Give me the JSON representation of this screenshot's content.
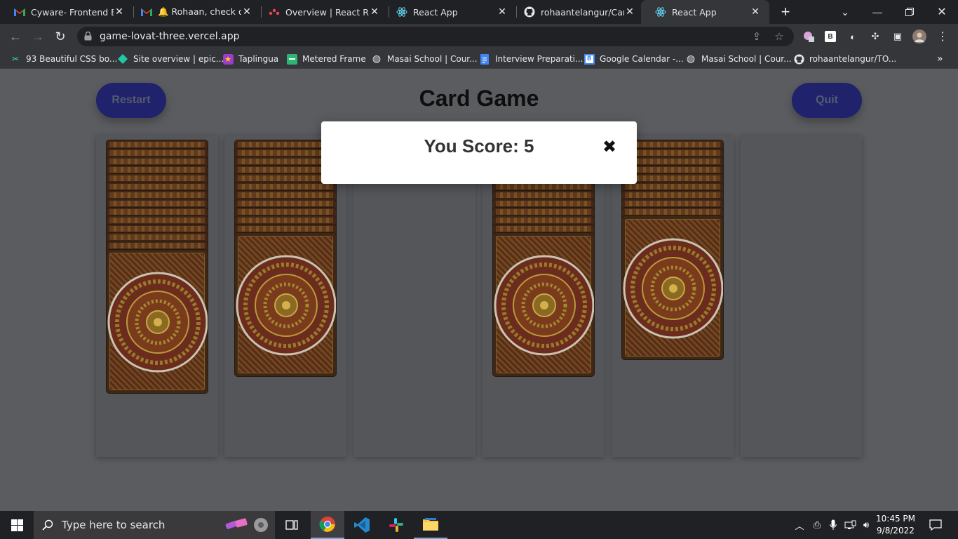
{
  "browser": {
    "tabs": [
      {
        "title": "Cyware- Frontend Eng",
        "icon": "gmail-icon"
      },
      {
        "title": "🔔 Rohaan, check out",
        "icon": "gmail-icon"
      },
      {
        "title": "Overview | React Rout",
        "icon": "react-router-icon"
      },
      {
        "title": "React App",
        "icon": "react-icon"
      },
      {
        "title": "rohaantelangur/Card_",
        "icon": "github-icon"
      },
      {
        "title": "React App",
        "icon": "react-icon",
        "active": true
      }
    ],
    "url": "game-lovat-three.vercel.app",
    "bookmarks": [
      "93 Beautiful CSS bo...",
      "Site overview | epic...",
      "Taplingua",
      "Metered Frame",
      "Masai School | Cour...",
      "Interview Preparati...",
      "Google Calendar -...",
      "Masai School | Cour...",
      "rohaantelangur/TO..."
    ]
  },
  "game": {
    "title": "Card Game",
    "restart_label": "Restart",
    "quit_label": "Quit",
    "columns_card_counts": [
      14,
      12,
      0,
      12,
      10,
      0
    ]
  },
  "modal": {
    "score_text": "You Score: 5",
    "close_symbol": "✖"
  },
  "taskbar": {
    "search_placeholder": "Type here to search",
    "time": "10:45 PM",
    "date": "9/8/2022"
  },
  "colors": {
    "page_bg": "#5a5c60",
    "button_bg": "#20236b",
    "card_back": "#5a2a1a",
    "modal_bg": "#ffffff"
  }
}
